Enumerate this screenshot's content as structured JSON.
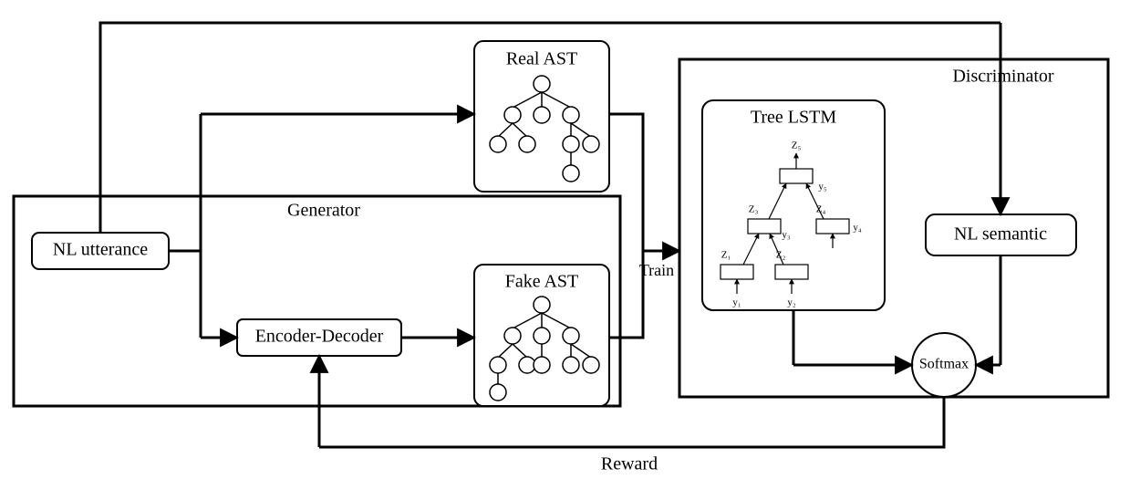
{
  "nl_utterance": "NL utterance",
  "generator_label": "Generator",
  "encoder_decoder": "Encoder-Decoder",
  "real_ast": "Real AST",
  "fake_ast": "Fake AST",
  "train_label": "Train",
  "discriminator_label": "Discriminator",
  "tree_lstm": "Tree LSTM",
  "nl_semantic": "NL semantic",
  "softmax": "Softmax",
  "reward_label": "Reward",
  "lstm_nodes": {
    "z1": "Z₁",
    "z2": "Z₂",
    "z3": "Z₃",
    "z4": "Z₄",
    "z5": "Z₅",
    "y1": "y₁",
    "y2": "y₂",
    "y3": "y₃",
    "y4": "y₄",
    "y5": "y₅"
  }
}
